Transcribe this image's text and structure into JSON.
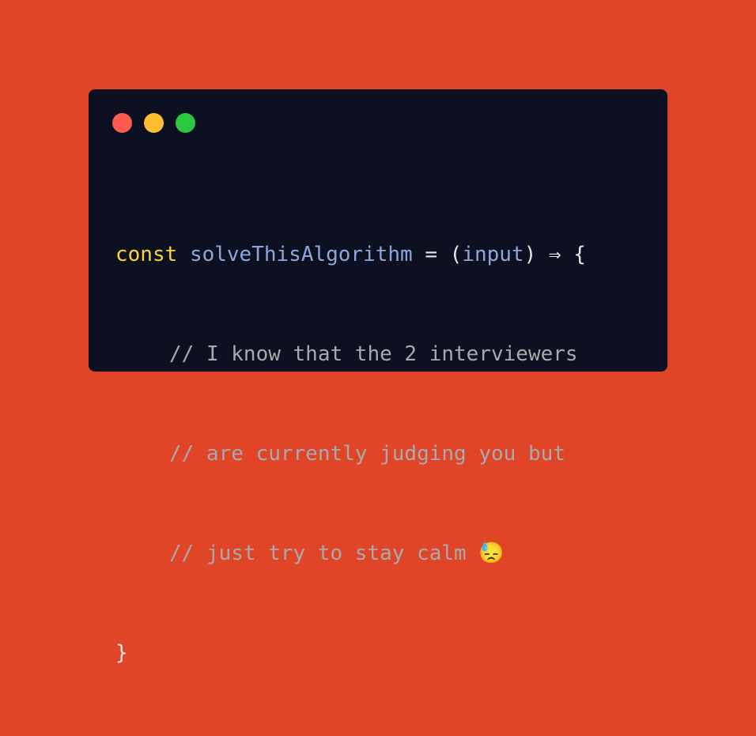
{
  "window": {
    "controls": {
      "close_color": "#ff5a52",
      "minimize_color": "#ffbe2f",
      "maximize_color": "#29c840"
    }
  },
  "code": {
    "line1": {
      "keyword": "const",
      "function_name": "solveThisAlgorithm",
      "equals": "=",
      "open_paren": "(",
      "param": "input",
      "close_paren": ")",
      "arrow": "⇒",
      "open_brace": "{"
    },
    "comments": [
      "// I know that the 2 interviewers",
      "// are currently judging you but",
      "// just try to stay calm 😓"
    ],
    "close_brace": "}"
  },
  "colors": {
    "background": "#e04527",
    "editor_background": "#0c1021",
    "keyword": "#f7d53a",
    "identifier": "#8fa7d8",
    "comment": "#a9a9ad"
  }
}
